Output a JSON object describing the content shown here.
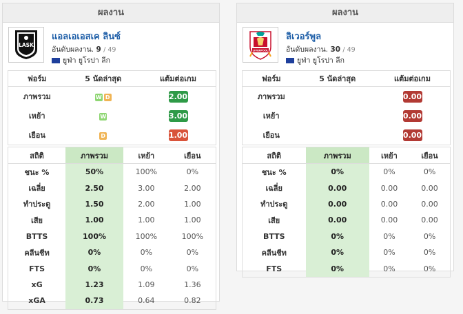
{
  "left": {
    "header": "ผลงาน",
    "team_name": "แอลเอเอสเค ลินซ์",
    "rank_label": "อันดับผลงาน.",
    "rank": "9",
    "rank_total": "/ 49",
    "league": "ยูฟ่า ยูโรปา ลีก",
    "logo_text": "LASK",
    "form_headers": [
      "ฟอร์ม",
      "5 นัดล่าสุด",
      "แต้มต่อเกม"
    ],
    "form_rows": [
      {
        "label": "ภาพรวม",
        "badges": [
          "W",
          "D"
        ],
        "ppg": "2.00",
        "ppg_color": "green"
      },
      {
        "label": "เหย้า",
        "badges": [
          "W"
        ],
        "ppg": "3.00",
        "ppg_color": "green"
      },
      {
        "label": "เยือน",
        "badges": [
          "D"
        ],
        "ppg": "1.00",
        "ppg_color": "orange"
      }
    ],
    "stats_headers": [
      "สถิติ",
      "ภาพรวม",
      "เหย้า",
      "เยือน"
    ],
    "stats_rows": [
      {
        "label": "ชนะ %",
        "overall": "50%",
        "home": "100%",
        "away": "0%"
      },
      {
        "label": "เฉลี่ย",
        "overall": "2.50",
        "home": "3.00",
        "away": "2.00"
      },
      {
        "label": "ทำประตู",
        "overall": "1.50",
        "home": "2.00",
        "away": "1.00"
      },
      {
        "label": "เสีย",
        "overall": "1.00",
        "home": "1.00",
        "away": "1.00"
      },
      {
        "label": "BTTS",
        "overall": "100%",
        "home": "100%",
        "away": "100%"
      },
      {
        "label": "คลีนชีท",
        "overall": "0%",
        "home": "0%",
        "away": "0%"
      },
      {
        "label": "FTS",
        "overall": "0%",
        "home": "0%",
        "away": "0%"
      },
      {
        "label": "xG",
        "overall": "1.23",
        "home": "1.09",
        "away": "1.36"
      },
      {
        "label": "xGA",
        "overall": "0.73",
        "home": "0.64",
        "away": "0.82"
      }
    ]
  },
  "right": {
    "header": "ผลงาน",
    "team_name": "ลิเวอร์พูล",
    "rank_label": "อันดับผลงาน.",
    "rank": "30",
    "rank_total": "/ 49",
    "league": "ยูฟ่า ยูโรปา ลีก",
    "logo_text": "LIVERPOOL",
    "form_headers": [
      "ฟอร์ม",
      "5 นัดล่าสุด",
      "แต้มต่อเกม"
    ],
    "form_rows": [
      {
        "label": "ภาพรวม",
        "badges": [],
        "ppg": "0.00",
        "ppg_color": "red"
      },
      {
        "label": "เหย้า",
        "badges": [],
        "ppg": "0.00",
        "ppg_color": "red"
      },
      {
        "label": "เยือน",
        "badges": [],
        "ppg": "0.00",
        "ppg_color": "red"
      }
    ],
    "stats_headers": [
      "สถิติ",
      "ภาพรวม",
      "เหย้า",
      "เยือน"
    ],
    "stats_rows": [
      {
        "label": "ชนะ %",
        "overall": "0%",
        "home": "0%",
        "away": "0%"
      },
      {
        "label": "เฉลี่ย",
        "overall": "0.00",
        "home": "0.00",
        "away": "0.00"
      },
      {
        "label": "ทำประตู",
        "overall": "0.00",
        "home": "0.00",
        "away": "0.00"
      },
      {
        "label": "เสีย",
        "overall": "0.00",
        "home": "0.00",
        "away": "0.00"
      },
      {
        "label": "BTTS",
        "overall": "0%",
        "home": "0%",
        "away": "0%"
      },
      {
        "label": "คลีนชีท",
        "overall": "0%",
        "home": "0%",
        "away": "0%"
      },
      {
        "label": "FTS",
        "overall": "0%",
        "home": "0%",
        "away": "0%"
      }
    ]
  },
  "colors": {
    "green": "#2e9a47",
    "orange": "#d9543b",
    "red": "#b23a34",
    "link": "#1f5fa8",
    "overall_bg": "#d9efd5"
  }
}
